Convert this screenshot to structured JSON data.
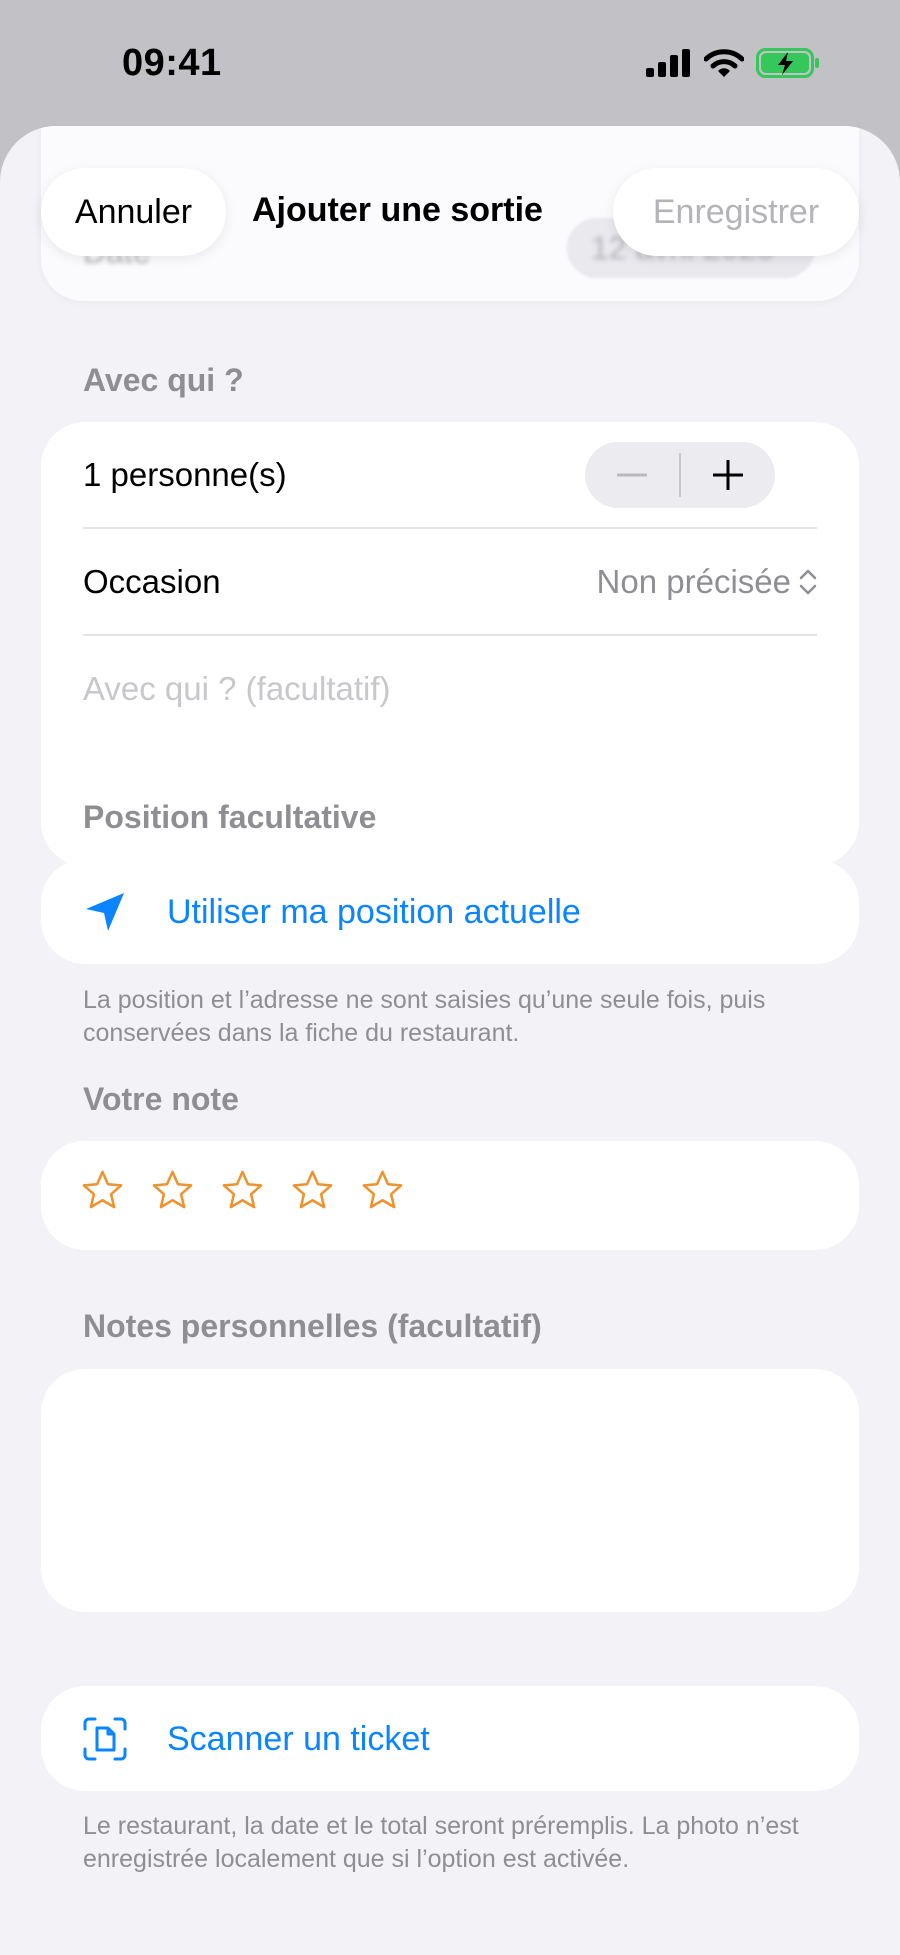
{
  "status_bar": {
    "time": "09:41"
  },
  "background": {
    "date_label": "Date",
    "date_value": "12 avril 2025"
  },
  "nav": {
    "cancel_label": "Annuler",
    "title": "Ajouter une sortie",
    "save_label": "Enregistrer"
  },
  "with_whom": {
    "header": "Avec qui ?",
    "people_label": "1 personne(s)",
    "people_count": 1,
    "stepper_minus": "−",
    "stepper_plus": "+",
    "occasion_label": "Occasion",
    "occasion_value": "Non précisée",
    "companions_placeholder": "Avec qui ? (facultatif)"
  },
  "location": {
    "header": "Position facultative",
    "use_current_label": "Utiliser ma position actuelle",
    "footnote": "La position et l’adresse ne sont saisies qu’une seule fois, puis conservées dans la fiche du restaurant."
  },
  "rating": {
    "header": "Votre note",
    "max": 5,
    "value": 0
  },
  "notes": {
    "header": "Notes personnelles (facultatif)",
    "value": ""
  },
  "scan": {
    "label": "Scanner un ticket",
    "footnote": "Le restaurant, la date et le total seront préremplis. La photo n’est enregistrée localement que si l’option est activée."
  },
  "colors": {
    "accent": "#0a84ff",
    "star": "#f0922d",
    "battery": "#34c759",
    "secondary_text": "#8e8e93",
    "placeholder": "#c7c7cc"
  },
  "icons": [
    "cellular-signal-icon",
    "wifi-icon",
    "battery-charging-icon",
    "location-arrow-icon",
    "star-outline-icon",
    "document-scanner-icon"
  ]
}
